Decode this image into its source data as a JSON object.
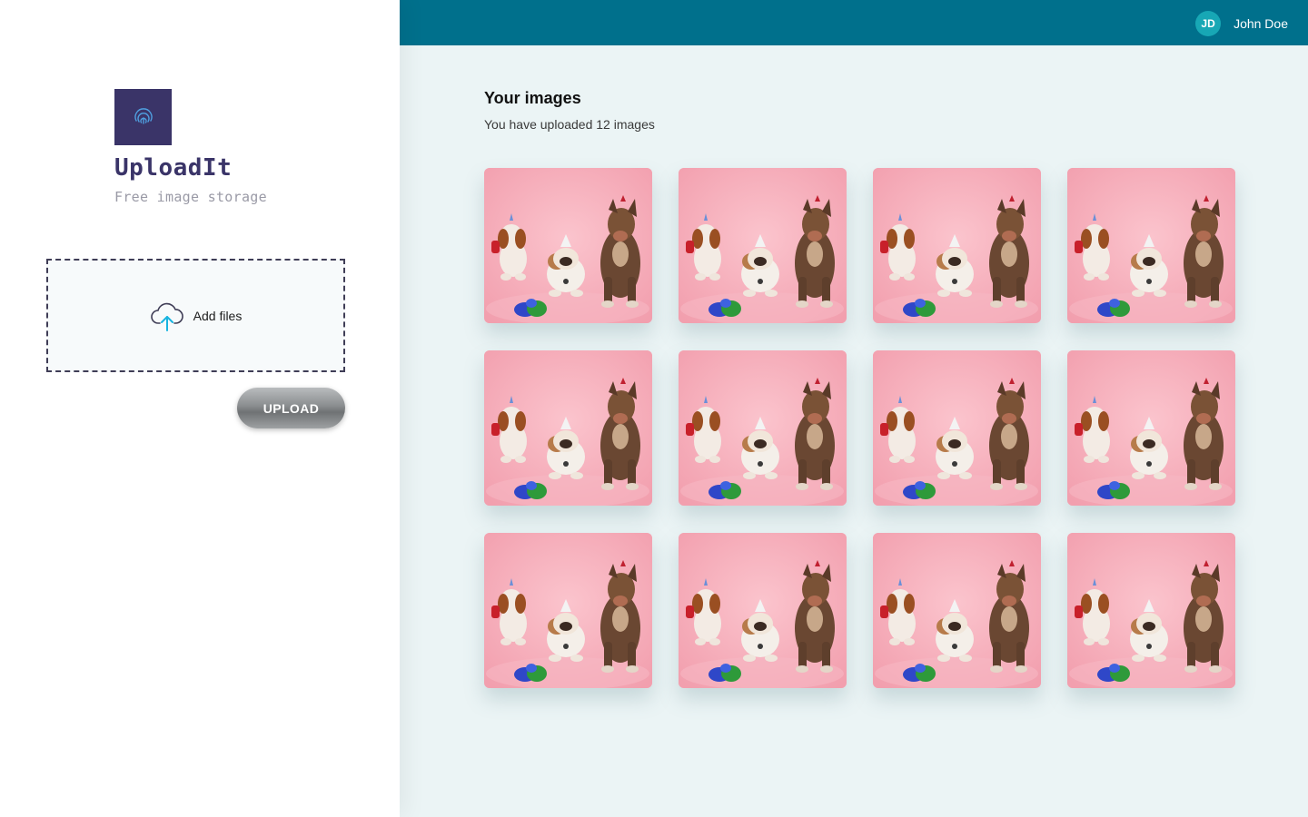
{
  "app": {
    "name": "UploadIt",
    "tagline": "Free image storage",
    "logo_icon": "fingerprint-icon"
  },
  "dropzone": {
    "label": "Add files",
    "icon": "cloud-upload-icon"
  },
  "upload_button": {
    "label": "UPLOAD"
  },
  "header": {
    "user": {
      "initials": "JD",
      "name": "John Doe"
    }
  },
  "gallery": {
    "title": "Your images",
    "subtitle": "You have uploaded 12 images",
    "image_count": 12
  },
  "colors": {
    "brand": "#3a3468",
    "header": "#00708c",
    "avatar": "#17a7b5",
    "background": "#ebf4f5"
  }
}
